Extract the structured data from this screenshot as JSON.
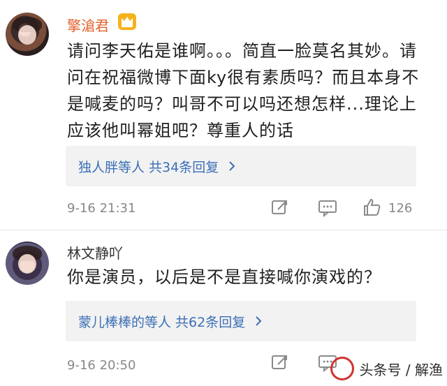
{
  "comments": [
    {
      "username": "擎滄君",
      "text": "请问李天佑是谁啊。。。简直一脸莫名其妙。请问在祝福微博下面ky很有素质吗？而且本身不是喊麦的吗？叫哥不可以吗还想怎样...理论上应该他叫幂姐吧？尊重人的话",
      "replies": "独人胖等人 共34条回复",
      "time": "9-16 21:31",
      "likes": "126",
      "crown_icon": "crown-icon"
    },
    {
      "username": "林文静吖",
      "text": "你是演员，以后是不是直接喊你演戏的？",
      "replies": "蒙儿棒棒的等人 共62条回复",
      "time": "9-16 20:50"
    }
  ],
  "watermark": "头条号 / 解渔",
  "colors": {
    "link": "#3b6fb6",
    "username_vip": "#e1622f",
    "meta": "#888888",
    "reply_bg": "#f2f2f2"
  }
}
